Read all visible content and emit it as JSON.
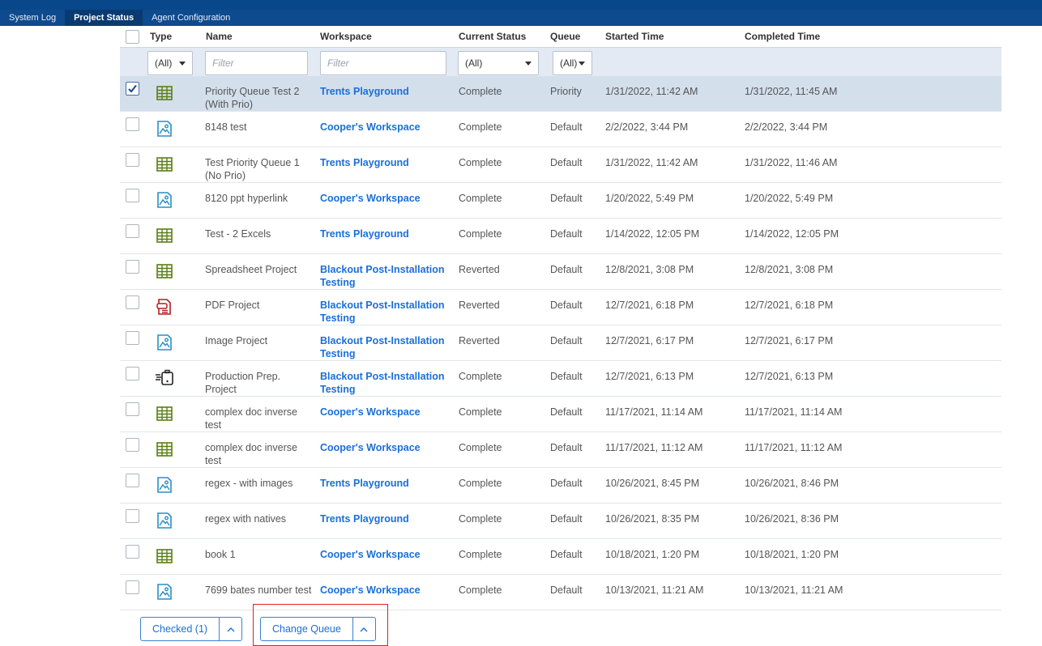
{
  "tabs": [
    {
      "label": "System Log",
      "active": false
    },
    {
      "label": "Project Status",
      "active": true
    },
    {
      "label": "Agent Configuration",
      "active": false
    }
  ],
  "columns": {
    "type": "Type",
    "name": "Name",
    "workspace": "Workspace",
    "status": "Current Status",
    "queue": "Queue",
    "started": "Started Time",
    "completed": "Completed Time"
  },
  "filters": {
    "type_selected": "(All)",
    "name_placeholder": "Filter",
    "workspace_placeholder": "Filter",
    "status_selected": "(All)",
    "queue_selected": "(All)"
  },
  "rows": [
    {
      "checked": true,
      "type": "spreadsheet-icon",
      "name": "Priority Queue Test 2 (With Prio)",
      "workspace": "Trents Playground",
      "status": "Complete",
      "queue": "Priority",
      "started": "1/31/2022, 11:42 AM",
      "completed": "1/31/2022, 11:45 AM"
    },
    {
      "checked": false,
      "type": "image-icon",
      "name": "8148 test",
      "workspace": "Cooper's Workspace",
      "status": "Complete",
      "queue": "Default",
      "started": "2/2/2022, 3:44 PM",
      "completed": "2/2/2022, 3:44 PM"
    },
    {
      "checked": false,
      "type": "spreadsheet-icon",
      "name": "Test Priority Queue 1 (No Prio)",
      "workspace": "Trents Playground",
      "status": "Complete",
      "queue": "Default",
      "started": "1/31/2022, 11:42 AM",
      "completed": "1/31/2022, 11:46 AM"
    },
    {
      "checked": false,
      "type": "image-icon",
      "name": "8120 ppt hyperlink",
      "workspace": "Cooper's Workspace",
      "status": "Complete",
      "queue": "Default",
      "started": "1/20/2022, 5:49 PM",
      "completed": "1/20/2022, 5:49 PM"
    },
    {
      "checked": false,
      "type": "spreadsheet-icon",
      "name": "Test - 2 Excels",
      "workspace": "Trents Playground",
      "status": "Complete",
      "queue": "Default",
      "started": "1/14/2022, 12:05 PM",
      "completed": "1/14/2022, 12:05 PM"
    },
    {
      "checked": false,
      "type": "spreadsheet-icon",
      "name": "Spreadsheet Project",
      "workspace": "Blackout Post-Installation Testing",
      "status": "Reverted",
      "queue": "Default",
      "started": "12/8/2021, 3:08 PM",
      "completed": "12/8/2021, 3:08 PM"
    },
    {
      "checked": false,
      "type": "pdf-icon",
      "name": "PDF Project",
      "workspace": "Blackout Post-Installation Testing",
      "status": "Reverted",
      "queue": "Default",
      "started": "12/7/2021, 6:18 PM",
      "completed": "12/7/2021, 6:18 PM"
    },
    {
      "checked": false,
      "type": "image-icon",
      "name": "Image Project",
      "workspace": "Blackout Post-Installation Testing",
      "status": "Reverted",
      "queue": "Default",
      "started": "12/7/2021, 6:17 PM",
      "completed": "12/7/2021, 6:17 PM"
    },
    {
      "checked": false,
      "type": "production-icon",
      "name": "Production Prep. Project",
      "workspace": "Blackout Post-Installation Testing",
      "status": "Complete",
      "queue": "Default",
      "started": "12/7/2021, 6:13 PM",
      "completed": "12/7/2021, 6:13 PM"
    },
    {
      "checked": false,
      "type": "spreadsheet-icon",
      "name": "complex doc inverse test",
      "workspace": "Cooper's Workspace",
      "status": "Complete",
      "queue": "Default",
      "started": "11/17/2021, 11:14 AM",
      "completed": "11/17/2021, 11:14 AM"
    },
    {
      "checked": false,
      "type": "spreadsheet-icon",
      "name": "complex doc inverse test",
      "workspace": "Cooper's Workspace",
      "status": "Complete",
      "queue": "Default",
      "started": "11/17/2021, 11:12 AM",
      "completed": "11/17/2021, 11:12 AM"
    },
    {
      "checked": false,
      "type": "image-icon",
      "name": "regex - with images",
      "workspace": "Trents Playground",
      "status": "Complete",
      "queue": "Default",
      "started": "10/26/2021, 8:45 PM",
      "completed": "10/26/2021, 8:46 PM"
    },
    {
      "checked": false,
      "type": "image-icon",
      "name": "regex with natives",
      "workspace": "Trents Playground",
      "status": "Complete",
      "queue": "Default",
      "started": "10/26/2021, 8:35 PM",
      "completed": "10/26/2021, 8:36 PM"
    },
    {
      "checked": false,
      "type": "spreadsheet-icon",
      "name": "book 1",
      "workspace": "Cooper's Workspace",
      "status": "Complete",
      "queue": "Default",
      "started": "10/18/2021, 1:20 PM",
      "completed": "10/18/2021, 1:20 PM"
    },
    {
      "checked": false,
      "type": "image-icon",
      "name": "7699 bates number test",
      "workspace": "Cooper's Workspace",
      "status": "Complete",
      "queue": "Default",
      "started": "10/13/2021, 11:21 AM",
      "completed": "10/13/2021, 11:21 AM"
    }
  ],
  "footer": {
    "checked_label": "Checked (1)",
    "change_queue_label": "Change Queue"
  },
  "colors": {
    "tab_bar": "#0d4a8e",
    "link": "#1a6fd8",
    "selected_row": "#d4dfec",
    "filter_bar": "#e3eaf3",
    "spreadsheet_icon": "#5a7f12",
    "image_icon": "#2a8fc4",
    "pdf_icon": "#b71c1c",
    "highlight": "#e02020"
  }
}
